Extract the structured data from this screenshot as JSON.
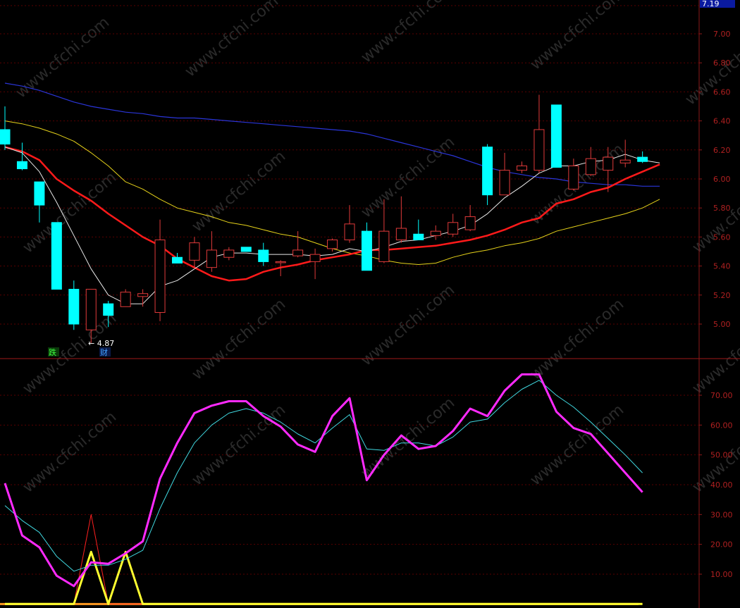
{
  "price_box": "7.19",
  "watermark": "www.cfchi.com",
  "colors": {
    "up": "#e03a3a",
    "down": "#00ffff",
    "grid": "#5a0000",
    "axis": "#8a1a1a",
    "tick": "#b02020",
    "ma_white": "#e8e8e8",
    "ma_red": "#ff1a1a",
    "ma_yellow": "#e6d21a",
    "ma_blue": "#2a35d8",
    "k_line": "#ff2aff",
    "d_line": "#40d8e0",
    "sig_red": "#ff2020",
    "sig_yellow": "#ffff30",
    "base_orange": "#ff9a20"
  },
  "chart_data": [
    {
      "type": "candlestick",
      "ylim": [
        4.8,
        7.19
      ],
      "yticks": [
        "7.00",
        "6.80",
        "6.60",
        "6.40",
        "6.20",
        "6.00",
        "5.80",
        "5.60",
        "5.40",
        "5.20",
        "5.00"
      ],
      "candles": [
        {
          "o": 6.34,
          "h": 6.5,
          "l": 6.2,
          "c": 6.24
        },
        {
          "o": 6.12,
          "h": 6.25,
          "l": 6.06,
          "c": 6.07
        },
        {
          "o": 5.98,
          "h": 5.98,
          "l": 5.7,
          "c": 5.82
        },
        {
          "o": 5.7,
          "h": 5.7,
          "l": 5.24,
          "c": 5.24
        },
        {
          "o": 5.24,
          "h": 5.3,
          "l": 4.96,
          "c": 5.0
        },
        {
          "o": 4.96,
          "h": 5.24,
          "l": 4.87,
          "c": 5.24
        },
        {
          "o": 5.14,
          "h": 5.16,
          "l": 4.98,
          "c": 5.06
        },
        {
          "o": 5.12,
          "h": 5.24,
          "l": 5.12,
          "c": 5.22
        },
        {
          "o": 5.19,
          "h": 5.24,
          "l": 5.12,
          "c": 5.21
        },
        {
          "o": 5.08,
          "h": 5.72,
          "l": 5.02,
          "c": 5.58
        },
        {
          "o": 5.46,
          "h": 5.49,
          "l": 5.42,
          "c": 5.42
        },
        {
          "o": 5.44,
          "h": 5.6,
          "l": 5.38,
          "c": 5.56
        },
        {
          "o": 5.39,
          "h": 5.64,
          "l": 5.36,
          "c": 5.51
        },
        {
          "o": 5.46,
          "h": 5.53,
          "l": 5.44,
          "c": 5.51
        },
        {
          "o": 5.53,
          "h": 5.53,
          "l": 5.5,
          "c": 5.5
        },
        {
          "o": 5.51,
          "h": 5.56,
          "l": 5.4,
          "c": 5.43
        },
        {
          "o": 5.43,
          "h": 5.44,
          "l": 5.33,
          "c": 5.43
        },
        {
          "o": 5.47,
          "h": 5.64,
          "l": 5.46,
          "c": 5.51
        },
        {
          "o": 5.43,
          "h": 5.52,
          "l": 5.31,
          "c": 5.48
        },
        {
          "o": 5.52,
          "h": 5.59,
          "l": 5.5,
          "c": 5.58
        },
        {
          "o": 5.58,
          "h": 5.82,
          "l": 5.56,
          "c": 5.69
        },
        {
          "o": 5.64,
          "h": 5.7,
          "l": 5.37,
          "c": 5.37
        },
        {
          "o": 5.43,
          "h": 5.86,
          "l": 5.42,
          "c": 5.64
        },
        {
          "o": 5.58,
          "h": 5.88,
          "l": 5.56,
          "c": 5.66
        },
        {
          "o": 5.62,
          "h": 5.72,
          "l": 5.58,
          "c": 5.58
        },
        {
          "o": 5.61,
          "h": 5.68,
          "l": 5.58,
          "c": 5.64
        },
        {
          "o": 5.62,
          "h": 5.76,
          "l": 5.6,
          "c": 5.7
        },
        {
          "o": 5.65,
          "h": 5.82,
          "l": 5.64,
          "c": 5.74
        },
        {
          "o": 6.22,
          "h": 6.24,
          "l": 5.82,
          "c": 5.89
        },
        {
          "o": 5.89,
          "h": 6.18,
          "l": 5.89,
          "c": 6.06
        },
        {
          "o": 6.06,
          "h": 6.12,
          "l": 6.04,
          "c": 6.09
        },
        {
          "o": 6.06,
          "h": 6.58,
          "l": 6.04,
          "c": 6.34
        },
        {
          "o": 6.51,
          "h": 6.51,
          "l": 6.08,
          "c": 6.08
        },
        {
          "o": 5.93,
          "h": 6.14,
          "l": 5.92,
          "c": 6.09
        },
        {
          "o": 6.03,
          "h": 6.22,
          "l": 6.02,
          "c": 6.14
        },
        {
          "o": 6.06,
          "h": 6.22,
          "l": 5.91,
          "c": 6.15
        },
        {
          "o": 6.11,
          "h": 6.27,
          "l": 6.08,
          "c": 6.13
        },
        {
          "o": 6.15,
          "h": 6.19,
          "l": 6.11,
          "c": 6.12
        }
      ],
      "ma_white": [
        6.22,
        6.18,
        6.05,
        5.84,
        5.61,
        5.38,
        5.2,
        5.14,
        5.14,
        5.26,
        5.3,
        5.38,
        5.46,
        5.49,
        5.49,
        5.48,
        5.48,
        5.48,
        5.47,
        5.48,
        5.52,
        5.5,
        5.53,
        5.57,
        5.58,
        5.61,
        5.64,
        5.68,
        5.76,
        5.87,
        5.95,
        6.04,
        6.09,
        6.09,
        6.12,
        6.13,
        6.17,
        6.13,
        6.11
      ],
      "ma_red": [
        6.22,
        6.19,
        6.13,
        6.0,
        5.92,
        5.85,
        5.76,
        5.68,
        5.6,
        5.54,
        5.45,
        5.39,
        5.33,
        5.3,
        5.31,
        5.36,
        5.39,
        5.41,
        5.44,
        5.46,
        5.48,
        5.51,
        5.51,
        5.52,
        5.53,
        5.54,
        5.56,
        5.58,
        5.61,
        5.65,
        5.7,
        5.73,
        5.83,
        5.86,
        5.91,
        5.94,
        6.0,
        6.05,
        6.1
      ],
      "ma_yellow": [
        6.4,
        6.38,
        6.35,
        6.31,
        6.26,
        6.18,
        6.09,
        5.98,
        5.93,
        5.86,
        5.8,
        5.77,
        5.74,
        5.7,
        5.68,
        5.65,
        5.62,
        5.6,
        5.56,
        5.52,
        5.49,
        5.47,
        5.44,
        5.42,
        5.41,
        5.42,
        5.46,
        5.49,
        5.51,
        5.54,
        5.56,
        5.59,
        5.64,
        5.67,
        5.7,
        5.73,
        5.76,
        5.8,
        5.86
      ],
      "ma_blue": [
        6.66,
        6.64,
        6.61,
        6.57,
        6.53,
        6.5,
        6.48,
        6.46,
        6.45,
        6.43,
        6.42,
        6.42,
        6.41,
        6.4,
        6.39,
        6.38,
        6.37,
        6.36,
        6.35,
        6.34,
        6.33,
        6.31,
        6.28,
        6.25,
        6.22,
        6.19,
        6.16,
        6.12,
        6.08,
        6.05,
        6.03,
        6.01,
        6.0,
        5.98,
        5.97,
        5.96,
        5.96,
        5.95,
        5.95
      ],
      "annotations": [
        "4.87",
        "跌",
        "财"
      ]
    },
    {
      "type": "line",
      "ylim": [
        0,
        80
      ],
      "yticks": [
        "70.00",
        "60.00",
        "50.00",
        "40.00",
        "30.00",
        "20.00",
        "10.00"
      ],
      "series": [
        {
          "values": [
            40.5,
            23,
            19,
            9.5,
            6,
            14,
            13.5,
            17,
            21,
            42,
            54,
            64,
            66.5,
            68,
            68,
            63,
            59.5,
            53.5,
            51,
            63,
            69,
            41.5,
            50,
            56.5,
            52,
            53,
            58,
            65.5,
            63,
            71.5,
            77,
            77,
            64.5,
            59,
            57,
            50.5,
            44,
            37.5
          ]
        },
        {
          "values": [
            33,
            28,
            24,
            16,
            11,
            13,
            13,
            15,
            18,
            32,
            44,
            54,
            60,
            64,
            65.5,
            64,
            61,
            57,
            54,
            59,
            63.5,
            52,
            51.5,
            54,
            54,
            53,
            56,
            61,
            62,
            67.5,
            72,
            75,
            70,
            66,
            61,
            55.5,
            50,
            44
          ]
        },
        {
          "values": [
            0,
            0,
            0,
            0,
            0,
            30,
            0,
            0,
            0,
            0,
            0,
            0,
            0,
            0,
            0,
            0,
            0,
            0,
            0,
            0,
            0,
            0,
            0,
            0,
            0,
            0,
            0,
            0,
            0,
            0,
            0,
            0,
            0,
            0,
            0,
            0,
            0,
            0
          ]
        },
        {
          "values": [
            0,
            0,
            0,
            0,
            0,
            17.5,
            0,
            17.5,
            0,
            0,
            0,
            0,
            0,
            0,
            0,
            0,
            0,
            0,
            0,
            0,
            0,
            0,
            0,
            0,
            0,
            0,
            0,
            0,
            0,
            0,
            0,
            0,
            0,
            0,
            0,
            0,
            0,
            0
          ]
        }
      ]
    }
  ]
}
